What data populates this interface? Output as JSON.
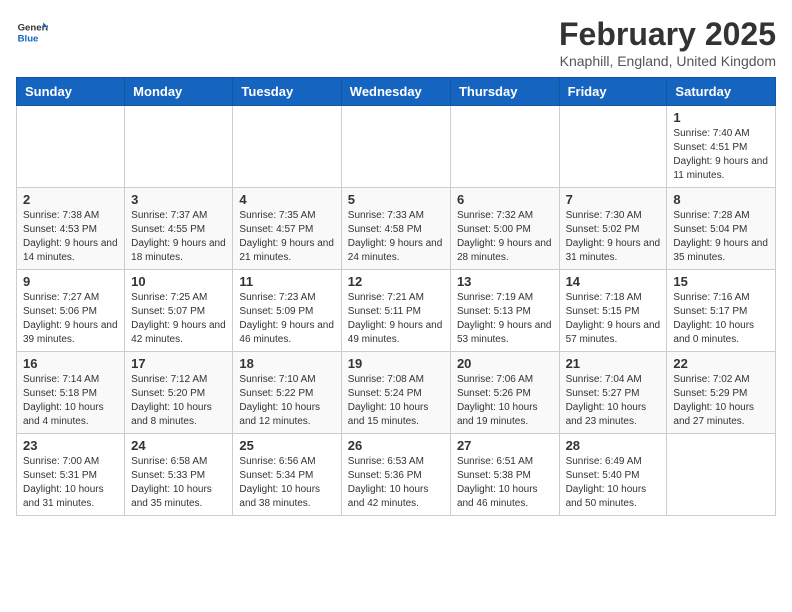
{
  "logo": {
    "general": "General",
    "blue": "Blue"
  },
  "title": "February 2025",
  "subtitle": "Knaphill, England, United Kingdom",
  "headers": [
    "Sunday",
    "Monday",
    "Tuesday",
    "Wednesday",
    "Thursday",
    "Friday",
    "Saturday"
  ],
  "weeks": [
    [
      {
        "day": "",
        "info": ""
      },
      {
        "day": "",
        "info": ""
      },
      {
        "day": "",
        "info": ""
      },
      {
        "day": "",
        "info": ""
      },
      {
        "day": "",
        "info": ""
      },
      {
        "day": "",
        "info": ""
      },
      {
        "day": "1",
        "info": "Sunrise: 7:40 AM\nSunset: 4:51 PM\nDaylight: 9 hours and 11 minutes."
      }
    ],
    [
      {
        "day": "2",
        "info": "Sunrise: 7:38 AM\nSunset: 4:53 PM\nDaylight: 9 hours and 14 minutes."
      },
      {
        "day": "3",
        "info": "Sunrise: 7:37 AM\nSunset: 4:55 PM\nDaylight: 9 hours and 18 minutes."
      },
      {
        "day": "4",
        "info": "Sunrise: 7:35 AM\nSunset: 4:57 PM\nDaylight: 9 hours and 21 minutes."
      },
      {
        "day": "5",
        "info": "Sunrise: 7:33 AM\nSunset: 4:58 PM\nDaylight: 9 hours and 24 minutes."
      },
      {
        "day": "6",
        "info": "Sunrise: 7:32 AM\nSunset: 5:00 PM\nDaylight: 9 hours and 28 minutes."
      },
      {
        "day": "7",
        "info": "Sunrise: 7:30 AM\nSunset: 5:02 PM\nDaylight: 9 hours and 31 minutes."
      },
      {
        "day": "8",
        "info": "Sunrise: 7:28 AM\nSunset: 5:04 PM\nDaylight: 9 hours and 35 minutes."
      }
    ],
    [
      {
        "day": "9",
        "info": "Sunrise: 7:27 AM\nSunset: 5:06 PM\nDaylight: 9 hours and 39 minutes."
      },
      {
        "day": "10",
        "info": "Sunrise: 7:25 AM\nSunset: 5:07 PM\nDaylight: 9 hours and 42 minutes."
      },
      {
        "day": "11",
        "info": "Sunrise: 7:23 AM\nSunset: 5:09 PM\nDaylight: 9 hours and 46 minutes."
      },
      {
        "day": "12",
        "info": "Sunrise: 7:21 AM\nSunset: 5:11 PM\nDaylight: 9 hours and 49 minutes."
      },
      {
        "day": "13",
        "info": "Sunrise: 7:19 AM\nSunset: 5:13 PM\nDaylight: 9 hours and 53 minutes."
      },
      {
        "day": "14",
        "info": "Sunrise: 7:18 AM\nSunset: 5:15 PM\nDaylight: 9 hours and 57 minutes."
      },
      {
        "day": "15",
        "info": "Sunrise: 7:16 AM\nSunset: 5:17 PM\nDaylight: 10 hours and 0 minutes."
      }
    ],
    [
      {
        "day": "16",
        "info": "Sunrise: 7:14 AM\nSunset: 5:18 PM\nDaylight: 10 hours and 4 minutes."
      },
      {
        "day": "17",
        "info": "Sunrise: 7:12 AM\nSunset: 5:20 PM\nDaylight: 10 hours and 8 minutes."
      },
      {
        "day": "18",
        "info": "Sunrise: 7:10 AM\nSunset: 5:22 PM\nDaylight: 10 hours and 12 minutes."
      },
      {
        "day": "19",
        "info": "Sunrise: 7:08 AM\nSunset: 5:24 PM\nDaylight: 10 hours and 15 minutes."
      },
      {
        "day": "20",
        "info": "Sunrise: 7:06 AM\nSunset: 5:26 PM\nDaylight: 10 hours and 19 minutes."
      },
      {
        "day": "21",
        "info": "Sunrise: 7:04 AM\nSunset: 5:27 PM\nDaylight: 10 hours and 23 minutes."
      },
      {
        "day": "22",
        "info": "Sunrise: 7:02 AM\nSunset: 5:29 PM\nDaylight: 10 hours and 27 minutes."
      }
    ],
    [
      {
        "day": "23",
        "info": "Sunrise: 7:00 AM\nSunset: 5:31 PM\nDaylight: 10 hours and 31 minutes."
      },
      {
        "day": "24",
        "info": "Sunrise: 6:58 AM\nSunset: 5:33 PM\nDaylight: 10 hours and 35 minutes."
      },
      {
        "day": "25",
        "info": "Sunrise: 6:56 AM\nSunset: 5:34 PM\nDaylight: 10 hours and 38 minutes."
      },
      {
        "day": "26",
        "info": "Sunrise: 6:53 AM\nSunset: 5:36 PM\nDaylight: 10 hours and 42 minutes."
      },
      {
        "day": "27",
        "info": "Sunrise: 6:51 AM\nSunset: 5:38 PM\nDaylight: 10 hours and 46 minutes."
      },
      {
        "day": "28",
        "info": "Sunrise: 6:49 AM\nSunset: 5:40 PM\nDaylight: 10 hours and 50 minutes."
      },
      {
        "day": "",
        "info": ""
      }
    ]
  ]
}
